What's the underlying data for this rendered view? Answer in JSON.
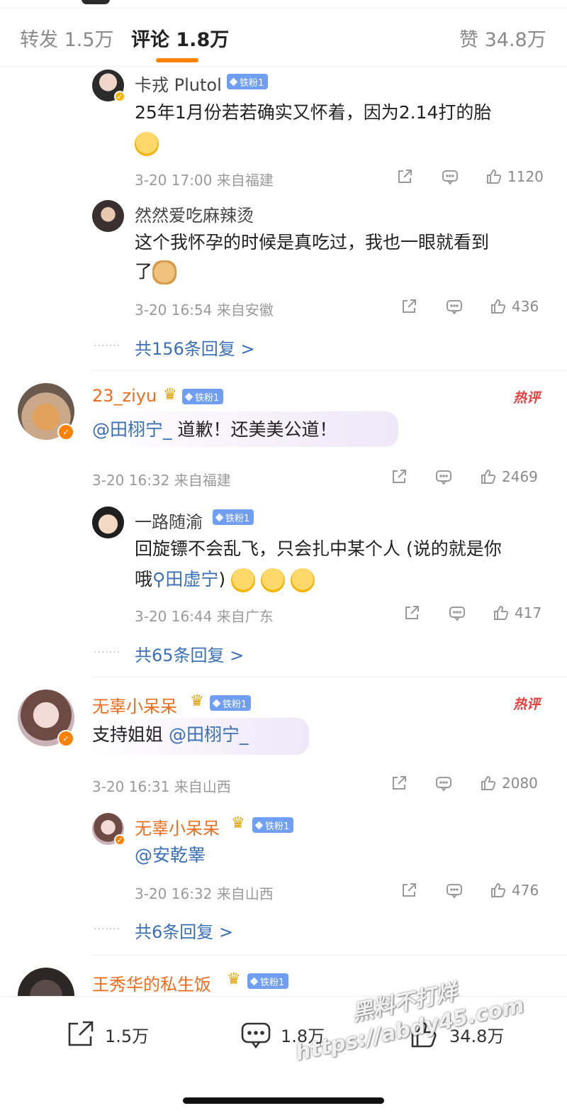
{
  "tabs": {
    "repost": "转发 1.5万",
    "comments": "评论 1.8万",
    "likes": "赞 34.8万"
  },
  "fan_badge": "铁粉1",
  "hot_label": "热评",
  "reply1": {
    "username": "卡戎 Plutol",
    "text": "25年1月份若若确实又怀着，因为2.14打的胎",
    "meta": "3-20 17:00  来自福建",
    "likes": "1120"
  },
  "reply2": {
    "username": "然然爱吃麻辣烫",
    "text_line1": "这个我怀孕的时候是真吃过，我也一眼就看到",
    "text_line2": "了",
    "meta": "3-20 16:54  来自安徽",
    "likes": "436"
  },
  "thread1_more": "共156条回复 >",
  "comment2": {
    "username": "23_ziyu",
    "mention": "@田栩宁_",
    "text": " 道歉！还美美公道！",
    "meta": "3-20 16:32  来自福建",
    "likes": "2469"
  },
  "reply3": {
    "username": "一路随渝",
    "text_line1": "回旋镖不会乱飞，只会扎中某个人 (说的就是你",
    "text_line2_prefix": "哦",
    "search_link": "田虚宁",
    "text_line2_suffix": ")",
    "meta": "3-20 16:44  来自广东",
    "likes": "417"
  },
  "thread2_more": "共65条回复 >",
  "comment3": {
    "username": "无辜小呆呆",
    "text": "支持姐姐 ",
    "mention": "@田栩宁_",
    "meta": "3-20 16:31  来自山西",
    "likes": "2080"
  },
  "reply4": {
    "username": "无辜小呆呆",
    "mention": "@安乾睾",
    "meta": "3-20 16:32  来自山西",
    "likes": "476"
  },
  "thread3_more": "共6条回复 >",
  "comment4": {
    "username": "王秀华的私生饭"
  },
  "bottom": {
    "repost": "1.5万",
    "comments": "1.8万",
    "likes": "34.8万"
  },
  "watermark": {
    "line1": "黑料不打烊",
    "line2": "https://abdy45.com"
  },
  "colors": {
    "accent": "#ff8200",
    "link": "#3b6fb6",
    "username_orange": "#f06c1e",
    "hot": "#ef3d3d"
  }
}
